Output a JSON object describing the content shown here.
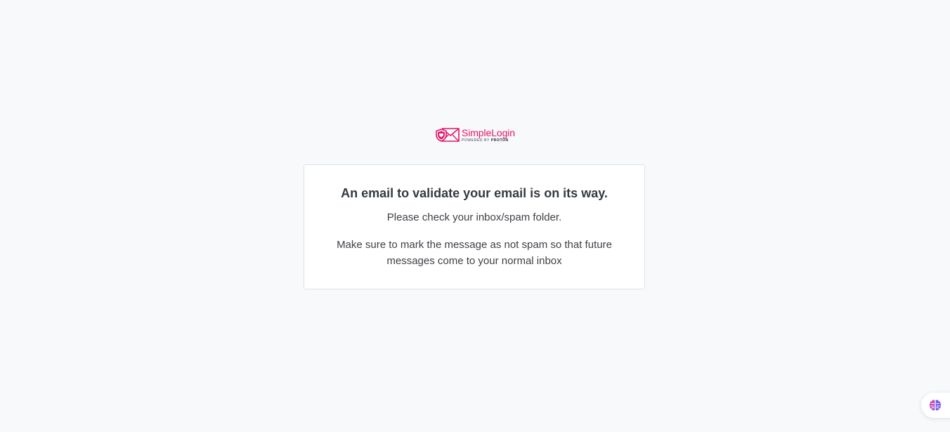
{
  "brand": {
    "name": "SimpleLogin",
    "powered_by": "POWERED BY",
    "powered_by_brand": "PROTON",
    "logo_icon": "shield-envelope-icon",
    "accent_color": "#e3156a"
  },
  "confirmation": {
    "title": "An email to validate your email is on its way.",
    "instruction": "Please check your inbox/spam folder.",
    "note": "Make sure to mark the message as not spam so that future messages come to your normal inbox"
  },
  "assistant_widget": {
    "icon": "brain-icon"
  }
}
